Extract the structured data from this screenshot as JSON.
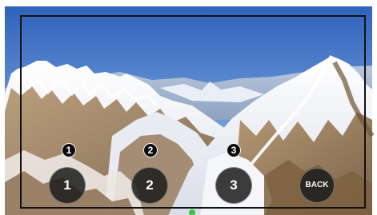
{
  "buttons": [
    {
      "label": "1",
      "marker": "1"
    },
    {
      "label": "2",
      "marker": "2"
    },
    {
      "label": "3",
      "marker": "3"
    }
  ],
  "back": {
    "label": "BACK"
  },
  "colors": {
    "sky_top": "#3d6fc3",
    "sky_bottom": "#a8c8ea",
    "snow": "#f2f3f7",
    "rock": "#9a7a55",
    "button": "#1c1c1c",
    "indicator": "#2fc944"
  }
}
